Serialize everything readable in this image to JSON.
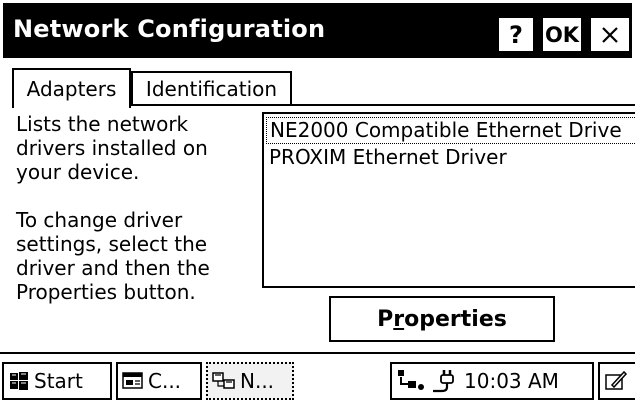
{
  "window": {
    "title": "Network Configuration",
    "help_label": "?",
    "ok_label": "OK",
    "close_label": "✕"
  },
  "tabs": [
    {
      "label": "Adapters",
      "active": true
    },
    {
      "label": "Identification",
      "active": false
    }
  ],
  "description": "Lists the network\ndrivers installed on\nyour device.\n\nTo change driver\nsettings, select the\ndriver and then the\nProperties button.",
  "adapters": {
    "items": [
      {
        "label": "NE2000 Compatible Ethernet Drive",
        "selected": true
      },
      {
        "label": "PROXIM Ethernet Driver",
        "selected": false
      }
    ]
  },
  "properties_button": {
    "pre": "P",
    "underlined": "r",
    "post": "operties"
  },
  "taskbar": {
    "start_label": "Start",
    "app1_label": "C...",
    "app2_label": "N...",
    "clock": "10:03 AM"
  },
  "icons": {
    "start": "start-icon",
    "app1": "control-panel-icon",
    "app2": "network-icon",
    "tray_network": "network-status-icon",
    "tray_power": "power-icon",
    "edge": "stylus-icon"
  }
}
